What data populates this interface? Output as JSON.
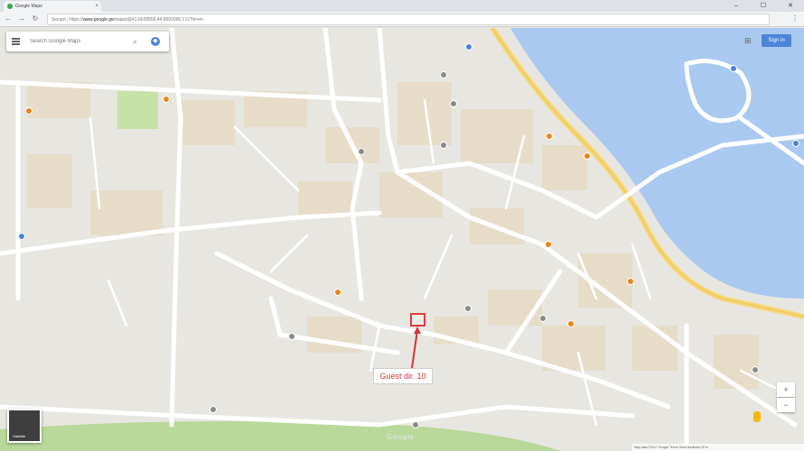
{
  "browser": {
    "tab_title": "Google Maps",
    "tab_close": "×",
    "window_controls": [
      "–",
      "☐",
      "✕"
    ],
    "url_prefix": "Secure | https://",
    "url_host": "www.google.ge",
    "url_path": "/maps/@41.6928858,44.8009096,17z?hl=en",
    "menu": "⋮"
  },
  "search": {
    "placeholder": "Search Google Maps"
  },
  "header": {
    "sign_in": "Sign in"
  },
  "marker": {
    "label": "Guest dir. 10"
  },
  "layers": {
    "label": "Satellite"
  },
  "footer": {
    "logo": "Google",
    "attribution": "Map data ©2017 Google   Terms   Send feedback   20 m"
  },
  "controls": {
    "zoom_in": "+",
    "zoom_out": "−"
  },
  "colors": {
    "river": "#a9c9f0",
    "highway": "#f7d774",
    "park": "#c7e2a8",
    "block": "#e6dcc8",
    "road": "#ffffff",
    "highlight": "#e33b3b"
  }
}
